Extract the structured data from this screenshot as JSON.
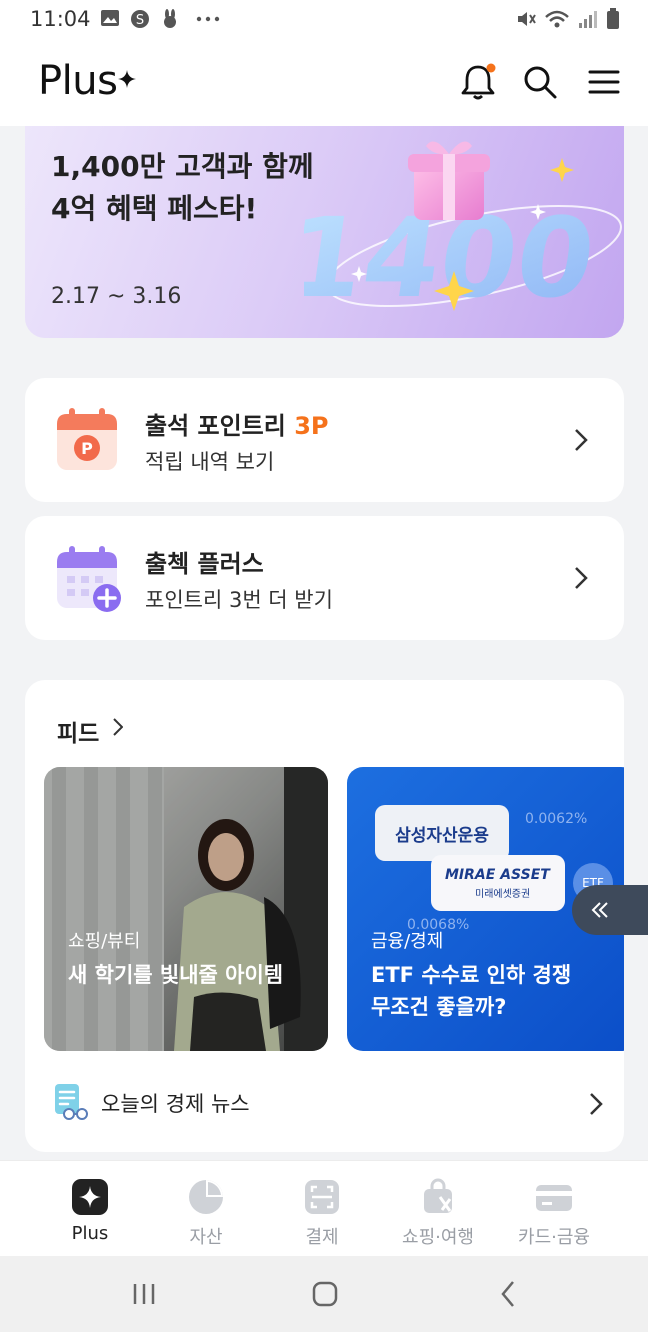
{
  "status_bar": {
    "time": "11:04",
    "left_icons": [
      "gallery-icon",
      "s-badge-icon",
      "rabbit-icon",
      "more-dots-icon"
    ],
    "right_icons": [
      "mute-icon",
      "wifi-icon",
      "signal-icon",
      "battery-icon"
    ]
  },
  "header": {
    "logo": "Plus",
    "icons": [
      "bell-icon",
      "search-icon",
      "menu-icon"
    ],
    "notification_dot_color": "#f5721b"
  },
  "banner": {
    "title": "1,400만 고객과 함께\n4억 혜택 페스타!",
    "date": "2.17 ~ 3.16",
    "art_text": "1400"
  },
  "attendance_card": {
    "title": "출석 포인트리",
    "points": "3P",
    "subtitle": "적립 내역 보기"
  },
  "plus_card": {
    "title": "출첵 플러스",
    "subtitle": "포인트리 3번 더 받기"
  },
  "feed": {
    "title": "피드",
    "cards": [
      {
        "category": "쇼핑/뷰티",
        "headline": "새 학기를 빛내줄 아이템"
      },
      {
        "category": "금융/경제",
        "headline": "ETF 수수료 인하 경쟁\n무조건 좋을까?",
        "tags": [
          "삼성자산운용",
          "MIRAE ASSET",
          "미래에셋증권",
          "0.0062%",
          "0.0068%",
          "ETF"
        ]
      }
    ],
    "news_label": "오늘의 경제 뉴스"
  },
  "bottom_nav": {
    "items": [
      {
        "label": "Plus",
        "icon": "plus-star-icon",
        "active": true
      },
      {
        "label": "자산",
        "icon": "pie-chart-icon",
        "active": false
      },
      {
        "label": "결제",
        "icon": "scan-icon",
        "active": false
      },
      {
        "label": "쇼핑·여행",
        "icon": "shopping-bag-icon",
        "active": false
      },
      {
        "label": "카드·금융",
        "icon": "card-icon",
        "active": false
      }
    ]
  },
  "system_nav": {
    "icons": [
      "recent-apps-icon",
      "home-icon",
      "back-icon"
    ]
  },
  "colors": {
    "accent": "#f5721b",
    "active_nav": "#222222",
    "inactive_nav": "#9a9ea5"
  }
}
